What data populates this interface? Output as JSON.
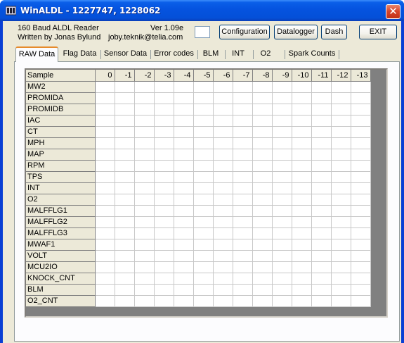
{
  "window": {
    "title": "WinALDL - 1227747, 1228062",
    "close_glyph": "✕",
    "title_icon": "app-icon",
    "colors": {
      "titlebar": "#0553df",
      "close": "#d6432a",
      "client": "#ece9d8",
      "tab_highlight": "#e68b2c"
    }
  },
  "info": {
    "line1": "160 Baud ALDL Reader",
    "line2": "Written by Jonas Bylund",
    "version": "Ver 1.09e",
    "email": "joby.teknik@telia.com"
  },
  "buttons": {
    "configuration": "Configuration",
    "datalogger": "Datalogger",
    "dash": "Dash",
    "exit": "EXIT"
  },
  "tabs": [
    {
      "label": "RAW Data",
      "active": true
    },
    {
      "label": "Flag Data",
      "active": false
    },
    {
      "label": "Sensor Data",
      "active": false
    },
    {
      "label": "Error codes",
      "active": false
    },
    {
      "label": "BLM",
      "active": false
    },
    {
      "label": "INT",
      "active": false
    },
    {
      "label": "O2",
      "active": false
    },
    {
      "label": "Spark Counts",
      "active": false
    }
  ],
  "grid": {
    "corner": "Sample",
    "columns": [
      "0",
      "-1",
      "-2",
      "-3",
      "-4",
      "-5",
      "-6",
      "-7",
      "-8",
      "-9",
      "-10",
      "-11",
      "-12",
      "-13"
    ],
    "rows": [
      "MW2",
      "PROMIDA",
      "PROMIDB",
      "IAC",
      "CT",
      "MPH",
      "MAP",
      "RPM",
      "TPS",
      "INT",
      "O2",
      "MALFFLG1",
      "MALFFLG2",
      "MALFFLG3",
      "MWAF1",
      "VOLT",
      "MCU2IO",
      "KNOCK_CNT",
      "BLM",
      "O2_CNT"
    ]
  }
}
